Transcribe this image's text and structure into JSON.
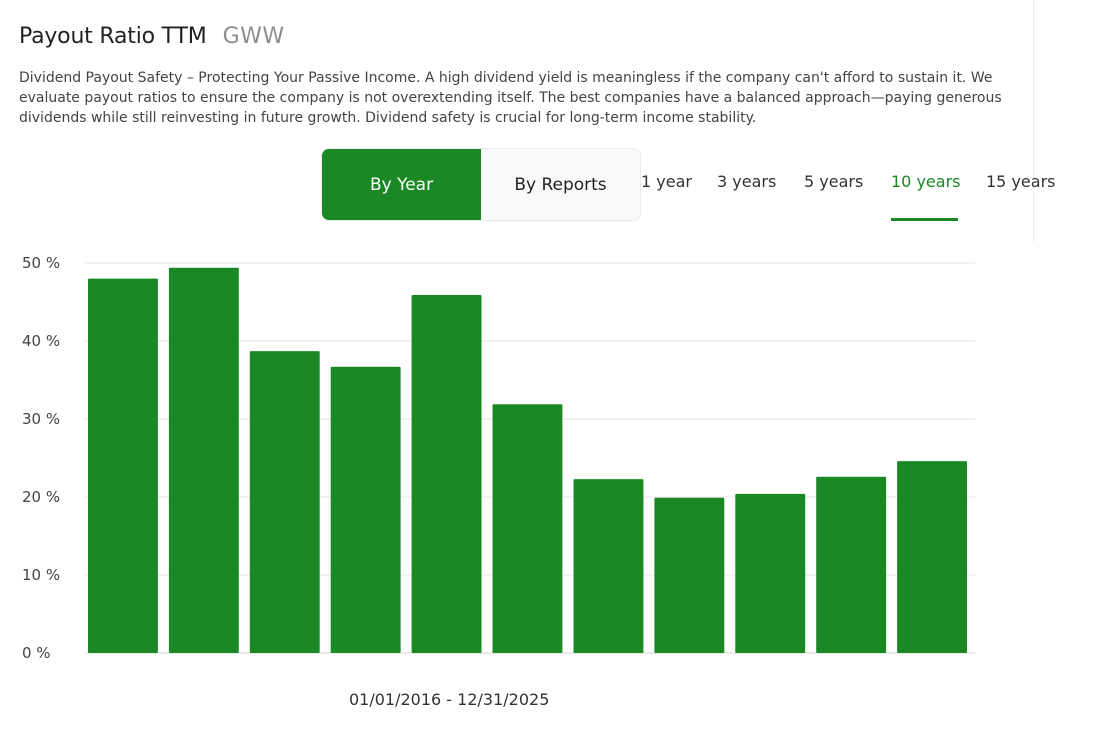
{
  "header": {
    "title": "Payout Ratio TTM",
    "ticker": "GWW"
  },
  "description": "Dividend Payout Safety – Protecting Your Passive Income. A high dividend yield is meaningless if the company can't afford to sustain it. We evaluate payout ratios to ensure the company is not overextending itself. The best companies have a balanced approach—paying generous dividends while still reinvesting in future growth. Dividend safety is crucial for long-term income stability.",
  "view_toggle": {
    "by_year": "By Year",
    "by_reports": "By Reports",
    "selected": "By Year"
  },
  "ranges": {
    "r1": "1 year",
    "r3": "3 years",
    "r5": "5 years",
    "r10": "10 years",
    "r15": "15 years",
    "selected": "10 years"
  },
  "period": "01/01/2016 - 12/31/2025",
  "colors": {
    "accent": "#1a8925",
    "bar": "#1a8925",
    "grid": "#e6e6e6"
  },
  "chart_data": {
    "type": "bar",
    "values": [
      48.0,
      49.4,
      38.7,
      36.7,
      45.9,
      31.9,
      22.3,
      19.9,
      20.4,
      22.6,
      24.6
    ],
    "ylim": [
      0,
      50
    ],
    "yticks": [
      "0 %",
      "10 %",
      "20 %",
      "30 %",
      "40 %",
      "50 %"
    ],
    "ytick_values": [
      0,
      10,
      20,
      30,
      40,
      50
    ],
    "grid": true
  }
}
